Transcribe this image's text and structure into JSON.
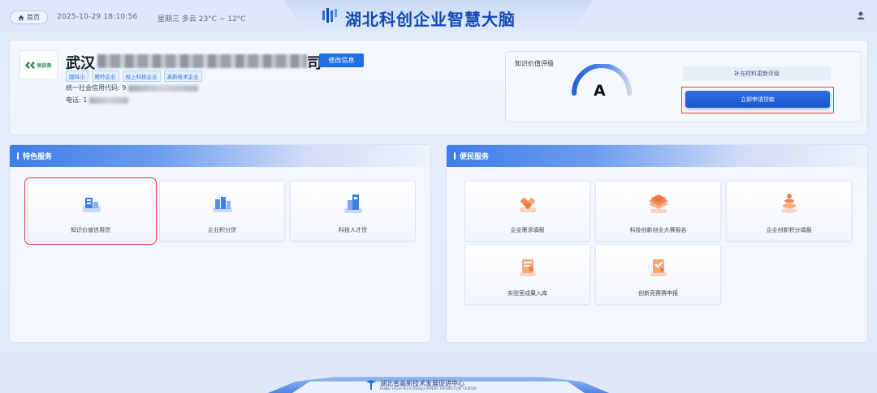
{
  "topbar": {
    "home_label": "首页",
    "datetime": "2025-10-29 18:10:56",
    "weather": "星期三  多云  23°C ~ 12°C",
    "title": "湖北科创企业智慧大脑"
  },
  "profile": {
    "logo_text": "锐卯美",
    "name_prefix": "武汉",
    "name_suffix": "司",
    "edit_label": "修改信息",
    "tags": [
      "国科小",
      "瞪羚企业",
      "规上科技企业",
      "高新技术企业"
    ],
    "credit_label": "统一社会信用代码: 9",
    "phone_label": "电话: 1"
  },
  "rating": {
    "label": "知识价值评级",
    "grade": "A",
    "supplement_label": "补充材料更新评级",
    "apply_label": "立即申请贷款"
  },
  "special_services": {
    "title": "特色服务",
    "items": [
      {
        "label": "知识价值信用贷",
        "icon": "credit-loan-icon"
      },
      {
        "label": "企业积分贷",
        "icon": "points-loan-icon"
      },
      {
        "label": "科技人才贷",
        "icon": "talent-loan-icon"
      }
    ]
  },
  "citizen_services": {
    "title": "便民服务",
    "items": [
      {
        "label": "企业需求填报",
        "icon": "demand-report-icon"
      },
      {
        "label": "科技创新创业大赛报名",
        "icon": "contest-signup-icon"
      },
      {
        "label": "企业创新积分填报",
        "icon": "innovation-points-icon"
      },
      {
        "label": "实验室成果入库",
        "icon": "lab-results-icon"
      },
      {
        "label": "创新竞赛赛申报",
        "icon": "competition-apply-icon"
      }
    ]
  },
  "footer": {
    "org": "湖北省高新技术发展促进中心",
    "org_en": "HUBEI HIGH-TECH DEVELOPMENT PROMOTION CENTER"
  },
  "colors": {
    "primary": "#1f6fe8",
    "title": "#1448b4",
    "highlight": "#e0453c"
  }
}
